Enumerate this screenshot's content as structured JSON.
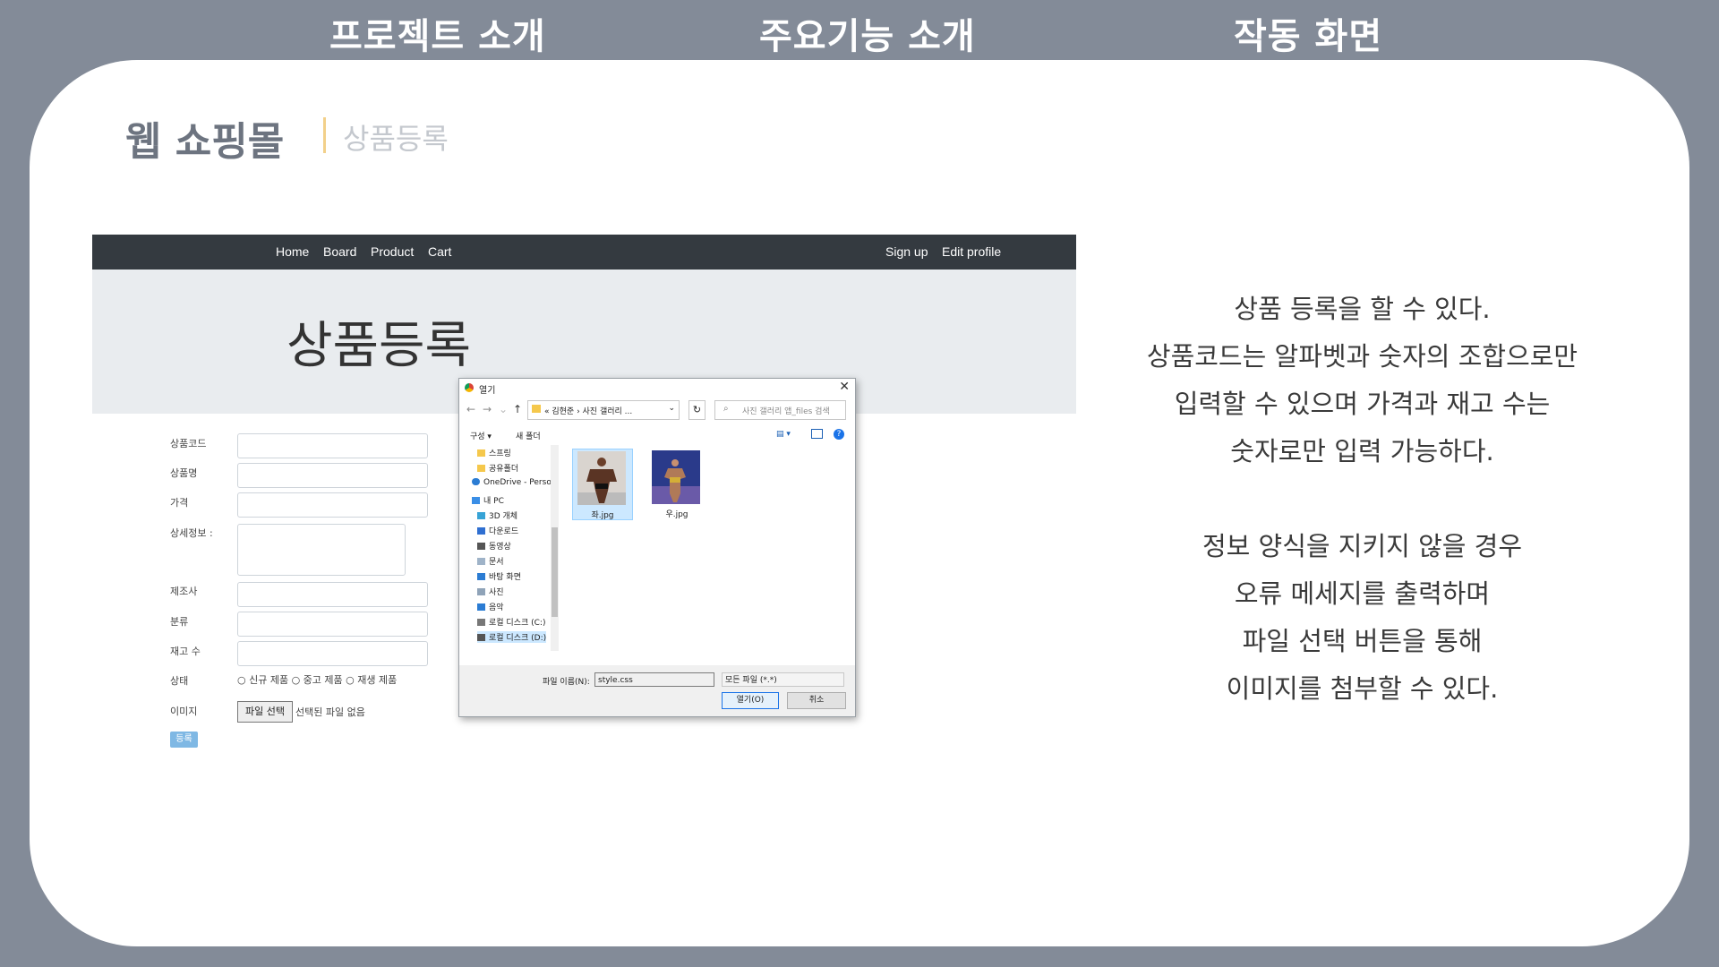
{
  "top_nav": [
    "프로젝트 소개",
    "주요기능 소개",
    "작동 화면"
  ],
  "slide": {
    "title": "웹 쇼핑몰",
    "subtitle": "상품등록"
  },
  "screenshot": {
    "navbar": {
      "left": [
        "Home",
        "Board",
        "Product",
        "Cart"
      ],
      "right": [
        "Sign up",
        "Edit profile"
      ]
    },
    "jumbotron_title": "상품등록",
    "form": {
      "labels": [
        "상품코드",
        "상품명",
        "가격",
        "상세정보 :",
        "제조사",
        "분류",
        "재고 수",
        "상태",
        "이미지"
      ],
      "status_options": "○ 신규 제품 ○ 중고 제품 ○ 재생 제품",
      "file_button": "파일 선택",
      "file_none": "선택된 파일 없음",
      "submit": "등록"
    },
    "file_dialog": {
      "title": "열기",
      "breadcrumb": "« 김현준 › 사진 갤러리 ...",
      "search_placeholder": "사진 갤러리 앱_files 검색",
      "toolbar": [
        "구성 ▾",
        "새 폴더"
      ],
      "tree": [
        "스프링",
        "공유폴더",
        "OneDrive - Persor",
        "내 PC",
        "3D 개체",
        "다운로드",
        "동영상",
        "문서",
        "바탕 화면",
        "사진",
        "음악",
        "로컬 디스크 (C:)",
        "로컬 디스크 (D:)"
      ],
      "files": [
        "좌.jpg",
        "우.jpg"
      ],
      "filename_label": "파일 이름(N):",
      "filename_value": "style.css",
      "filter": "모든 파일 (*.*)",
      "open_button": "열기(O)",
      "cancel_button": "취소"
    }
  },
  "description": {
    "paragraph1": [
      "상품 등록을 할 수 있다.",
      "상품코드는 알파벳과 숫자의 조합으로만",
      "입력할 수 있으며 가격과 재고 수는",
      "숫자로만 입력 가능하다."
    ],
    "paragraph2": [
      "정보 양식을 지키지 않을 경우",
      "오류 메세지를 출력하며",
      "파일 선택 버튼을 통해",
      "이미지를 첨부할 수 있다."
    ]
  }
}
